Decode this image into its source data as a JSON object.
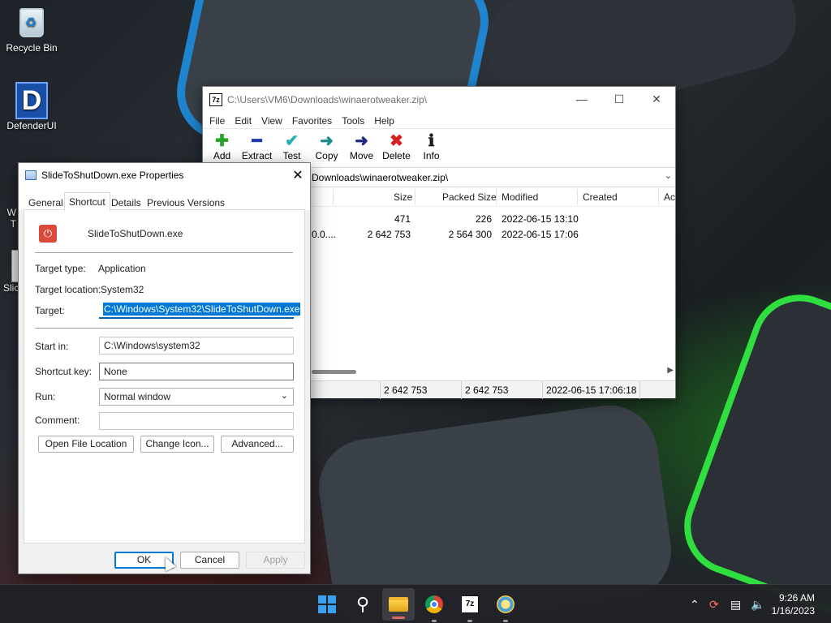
{
  "desktop": {
    "icons": [
      {
        "label": "Recycle Bin",
        "icon": "recycle-bin-icon"
      },
      {
        "label": "DefenderUI",
        "icon": "defender-icon"
      }
    ],
    "partial_labels": [
      "W",
      "T",
      "Slic"
    ]
  },
  "zip_window": {
    "title": "C:\\Users\\VM6\\Downloads\\winaerotweaker.zip\\",
    "menu": [
      "File",
      "Edit",
      "View",
      "Favorites",
      "Tools",
      "Help"
    ],
    "toolbar": [
      {
        "label": "Add",
        "icon": "plus-icon",
        "color": "#2aa52a",
        "glyph": "✚"
      },
      {
        "label": "Extract",
        "icon": "minus-icon",
        "color": "#1c3bb0",
        "glyph": "━"
      },
      {
        "label": "Test",
        "icon": "check-icon",
        "color": "#20b0b0",
        "glyph": "✔"
      },
      {
        "label": "Copy",
        "icon": "copy-arrow-icon",
        "color": "#1c8c8c",
        "glyph": "➜"
      },
      {
        "label": "Move",
        "icon": "move-arrow-icon",
        "color": "#1c2a80",
        "glyph": "➜"
      },
      {
        "label": "Delete",
        "icon": "delete-x-icon",
        "color": "#d42020",
        "glyph": "✖"
      },
      {
        "label": "Info",
        "icon": "info-icon",
        "color": "#1a1a1a",
        "glyph": "ℹ"
      }
    ],
    "address": "Downloads\\winaerotweaker.zip\\",
    "columns": [
      "Size",
      "Packed Size",
      "Modified",
      "Created",
      "Ac"
    ],
    "rows": [
      {
        "name": "",
        "size": "471",
        "packed": "226",
        "modified": "2022-06-15 13:10"
      },
      {
        "name": "0.0....",
        "size": "2 642 753",
        "packed": "2 564 300",
        "modified": "2022-06-15 17:06"
      }
    ],
    "status": {
      "size": "2 642 753",
      "packed": "2 642 753",
      "modified": "2022-06-15 17:06:18"
    }
  },
  "properties": {
    "title": "SlideToShutDown.exe Properties",
    "tabs": [
      "General",
      "Shortcut",
      "Details",
      "Previous Versions"
    ],
    "active_tab": "Shortcut",
    "file_name": "SlideToShutDown.exe",
    "target_type_label": "Target type:",
    "target_type": "Application",
    "target_location_label": "Target location:",
    "target_location": "System32",
    "target_label": "Target:",
    "target": "C:\\Windows\\System32\\SlideToShutDown.exe",
    "start_in_label": "Start in:",
    "start_in": "C:\\Windows\\system32",
    "shortcut_key_label": "Shortcut key:",
    "shortcut_key": "None",
    "run_label": "Run:",
    "run": "Normal window",
    "comment_label": "Comment:",
    "comment": "",
    "buttons": {
      "open_location": "Open File Location",
      "change_icon": "Change Icon...",
      "advanced": "Advanced...",
      "ok": "OK",
      "cancel": "Cancel",
      "apply": "Apply"
    }
  },
  "taskbar": {
    "time": "9:26 AM",
    "date": "1/16/2023"
  }
}
